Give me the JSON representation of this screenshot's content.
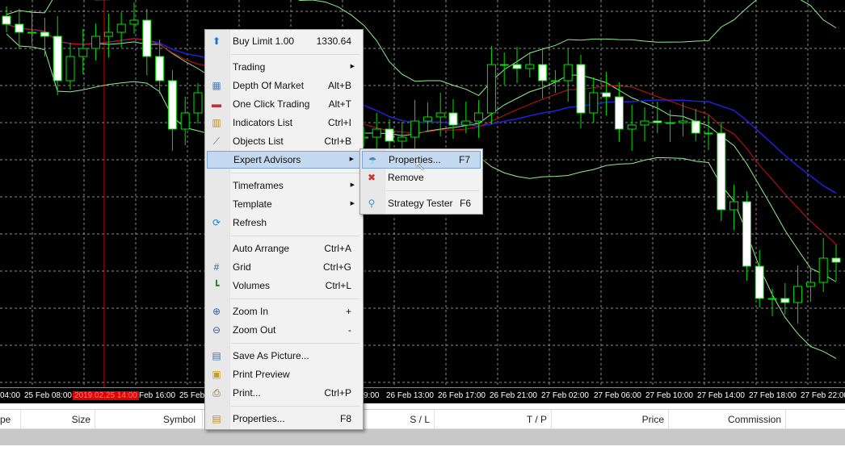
{
  "chart_data": {
    "type": "candlestick",
    "ylim": [
      1321,
      1345
    ],
    "closes": [
      1343.5,
      1343,
      1343,
      1342.75,
      1340,
      1341.5,
      1342,
      1342.75,
      1343,
      1343.5,
      1343.75,
      1341.5,
      1340,
      1337,
      1338,
      1339.25,
      1339,
      1339.5,
      1338.5,
      1337.5,
      1338,
      1337,
      1336.5,
      1337.5,
      1336.75,
      1336.25,
      1337,
      1336.5,
      1336.5,
      1337,
      1336.25,
      1336.5,
      1337.5,
      1337.75,
      1338,
      1337.25,
      1337.5,
      1338,
      1341,
      1341,
      1340.75,
      1341,
      1340,
      1340,
      1341,
      1338,
      1339.25,
      1339,
      1337,
      1337.25,
      1337.5,
      1337.4,
      1337.4,
      1337.5,
      1336.75,
      1336.75,
      1332,
      1332.5,
      1328.5,
      1326.5,
      1326.5,
      1326.25,
      1327.25,
      1327.5,
      1329,
      1328.75
    ],
    "colors": {
      "candle": "#00e000",
      "ma_fast": "#d01010",
      "ma_slow": "#2020e0",
      "bands": "#90ee90"
    }
  },
  "time_axis": [
    "04:00",
    "25 Feb 08:00",
    "2019.02.25 14:00",
    "Feb 16:00",
    "25 Feb",
    "9:00",
    "26 Feb 13:00",
    "26 Feb 17:00",
    "26 Feb 21:00",
    "27 Feb 02:00",
    "27 Feb 06:00",
    "27 Feb 10:00",
    "27 Feb 14:00",
    "27 Feb 18:00",
    "27 Feb 22:00"
  ],
  "columns": [
    "pe",
    "Size",
    "Symbol",
    "S / L",
    "T / P",
    "Price",
    "Commission"
  ],
  "menu": [
    {
      "label": "Buy Limit 1.00",
      "shortcut": "1330.64",
      "icon": "arrow-up-icon"
    },
    {
      "label": "Trading",
      "submenu": true
    },
    {
      "label": "Depth Of Market",
      "shortcut": "Alt+B",
      "icon": "depth-of-market-icon"
    },
    {
      "label": "One Click Trading",
      "shortcut": "Alt+T",
      "icon": "one-click-trading-icon"
    },
    {
      "label": "Indicators List",
      "shortcut": "Ctrl+I",
      "icon": "indicators-icon"
    },
    {
      "label": "Objects List",
      "shortcut": "Ctrl+B",
      "icon": "objects-icon"
    },
    {
      "label": "Expert Advisors",
      "submenu": true
    },
    {
      "label": "Timeframes",
      "submenu": true
    },
    {
      "label": "Template",
      "submenu": true
    },
    {
      "label": "Refresh",
      "icon": "refresh-icon"
    },
    {
      "label": "Auto Arrange",
      "shortcut": "Ctrl+A"
    },
    {
      "label": "Grid",
      "shortcut": "Ctrl+G",
      "icon": "grid-icon"
    },
    {
      "label": "Volumes",
      "shortcut": "Ctrl+L",
      "icon": "volumes-icon"
    },
    {
      "label": "Zoom In",
      "shortcut": "+",
      "icon": "zoom-in-icon"
    },
    {
      "label": "Zoom Out",
      "shortcut": "-",
      "icon": "zoom-out-icon"
    },
    {
      "label": "Save As Picture...",
      "icon": "save-picture-icon"
    },
    {
      "label": "Print Preview",
      "icon": "print-preview-icon"
    },
    {
      "label": "Print...",
      "shortcut": "Ctrl+P",
      "icon": "print-icon"
    },
    {
      "label": "Properties...",
      "shortcut": "F8",
      "icon": "properties-icon"
    }
  ],
  "submenu": [
    {
      "label": "Properties...",
      "shortcut": "F7",
      "icon": "ea-properties-icon"
    },
    {
      "label": "Remove",
      "icon": "ea-remove-icon"
    },
    {
      "label": "Strategy Tester",
      "shortcut": "F6",
      "icon": "strategy-tester-icon"
    }
  ]
}
